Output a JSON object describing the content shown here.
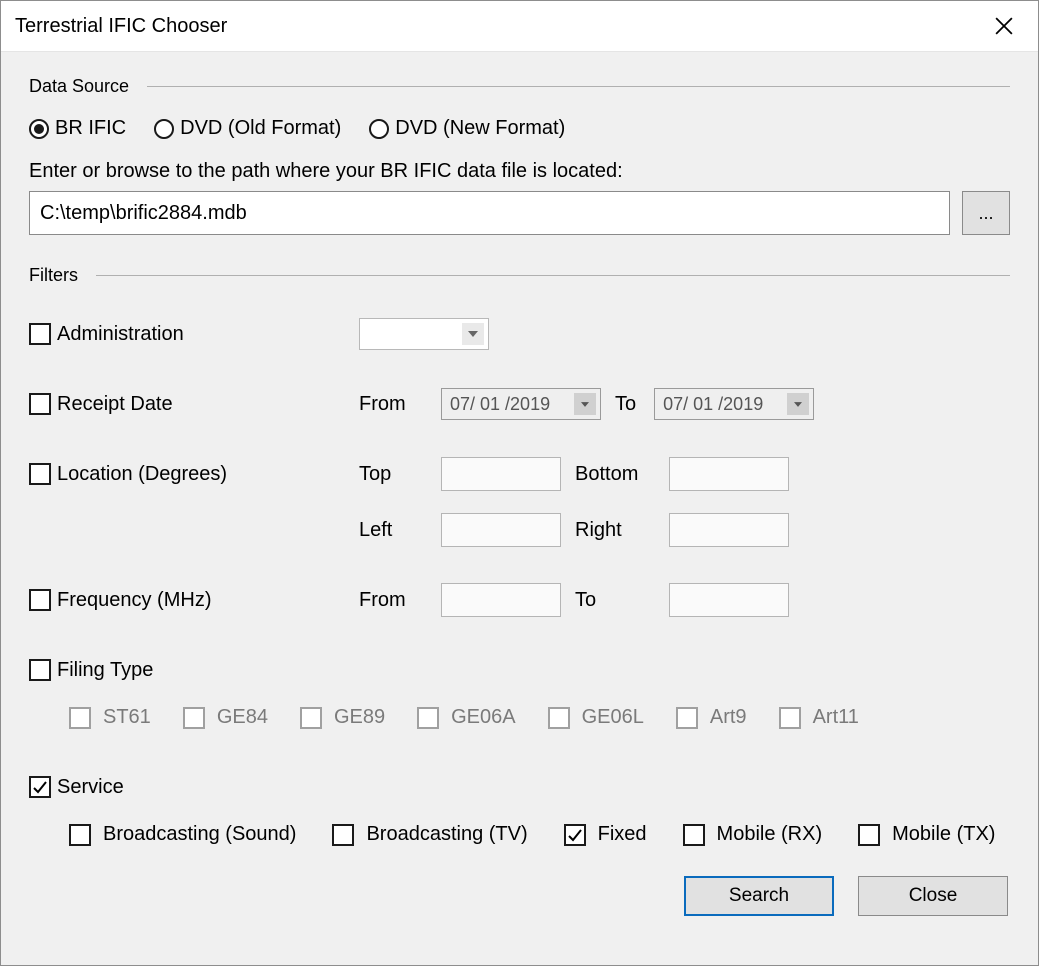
{
  "window": {
    "title": "Terrestrial IFIC Chooser"
  },
  "dataSource": {
    "heading": "Data Source",
    "options": {
      "brific": "BR IFIC",
      "dvdOld": "DVD (Old Format)",
      "dvdNew": "DVD (New Format)"
    },
    "selected": "brific",
    "prompt": "Enter or browse to the path where your BR IFIC data file is located:",
    "path": "C:\\temp\\brific2884.mdb",
    "browse": "..."
  },
  "filters": {
    "heading": "Filters",
    "admin": {
      "label": "Administration",
      "checked": false,
      "value": ""
    },
    "receipt": {
      "label": "Receipt Date",
      "checked": false,
      "fromLabel": "From",
      "toLabel": "To",
      "from": "07/ 01 /2019",
      "to": "07/ 01 /2019"
    },
    "location": {
      "label": "Location (Degrees)",
      "checked": false,
      "topLabel": "Top",
      "bottomLabel": "Bottom",
      "leftLabel": "Left",
      "rightLabel": "Right",
      "top": "",
      "bottom": "",
      "left": "",
      "right": ""
    },
    "frequency": {
      "label": "Frequency (MHz)",
      "checked": false,
      "fromLabel": "From",
      "toLabel": "To",
      "from": "",
      "to": ""
    },
    "filingType": {
      "label": "Filing Type",
      "checked": false,
      "options": {
        "st61": "ST61",
        "ge84": "GE84",
        "ge89": "GE89",
        "ge06a": "GE06A",
        "ge06l": "GE06L",
        "art9": "Art9",
        "art11": "Art11"
      }
    },
    "service": {
      "label": "Service",
      "checked": true,
      "options": {
        "bcSound": {
          "label": "Broadcasting (Sound)",
          "checked": false
        },
        "bcTv": {
          "label": "Broadcasting (TV)",
          "checked": false
        },
        "fixed": {
          "label": "Fixed",
          "checked": true
        },
        "mobRx": {
          "label": "Mobile (RX)",
          "checked": false
        },
        "mobTx": {
          "label": "Mobile (TX)",
          "checked": false
        }
      }
    }
  },
  "buttons": {
    "search": "Search",
    "close": "Close"
  }
}
